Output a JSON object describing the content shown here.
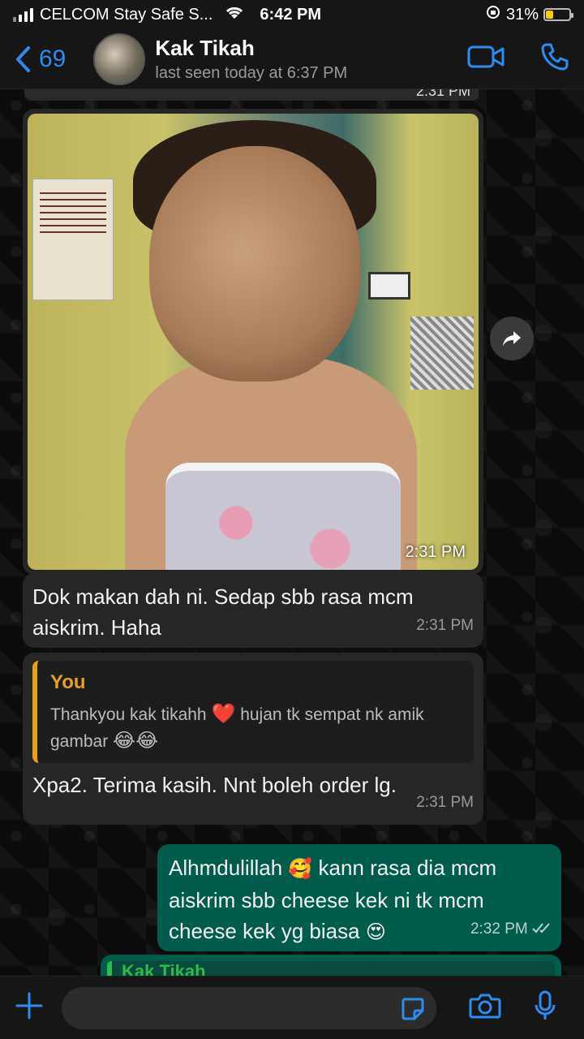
{
  "status_bar": {
    "carrier": "CELCOM Stay Safe S...",
    "time": "6:42 PM",
    "battery_percent": "31%",
    "battery_level": 0.31
  },
  "header": {
    "back_count": "69",
    "contact_name": "Kak Tikah",
    "last_seen": "last seen today at 6:37 PM"
  },
  "messages": {
    "partial_time": "2:31 PM",
    "photo_time": "2:31 PM",
    "msg1_text_line1": "Dok makan dah ni. Sedap sbb rasa mcm",
    "msg1_text_line2": "aiskrim. Haha",
    "msg1_time": "2:31 PM",
    "msg2_quote_author": "You",
    "msg2_quote_line1_a": "Thankyou kak tikahh",
    "msg2_quote_line1_b": "hujan tk sempat nk amik",
    "msg2_quote_line2": "gambar",
    "msg2_text": "Xpa2. Terima kasih. Nnt boleh order lg.",
    "msg2_time": "2:31 PM",
    "msg3_line1_a": "Alhmdulillah",
    "msg3_line1_b": "kann rasa dia mcm",
    "msg3_line2": "aiskrim sbb cheese kek ni tk mcm",
    "msg3_line3": "cheese kek yg biasa",
    "msg3_time": "2:32 PM",
    "partial_quote_author": "Kak Tikah"
  },
  "emoji": {
    "heart": "❤️",
    "laugh": "😂",
    "hug": "🥰",
    "heart_eyes": "😍"
  },
  "colors": {
    "accent": "#2d8cf0",
    "outgoing_bubble": "#005c4b",
    "incoming_bubble": "#262626",
    "quote_you": "#e4a21b",
    "quote_contact": "#2fbb4a"
  },
  "icons": [
    "chevron-left-icon",
    "video-call-icon",
    "phone-icon",
    "forward-icon",
    "plus-icon",
    "sticker-icon",
    "camera-icon",
    "microphone-icon",
    "read-receipt-icon"
  ]
}
